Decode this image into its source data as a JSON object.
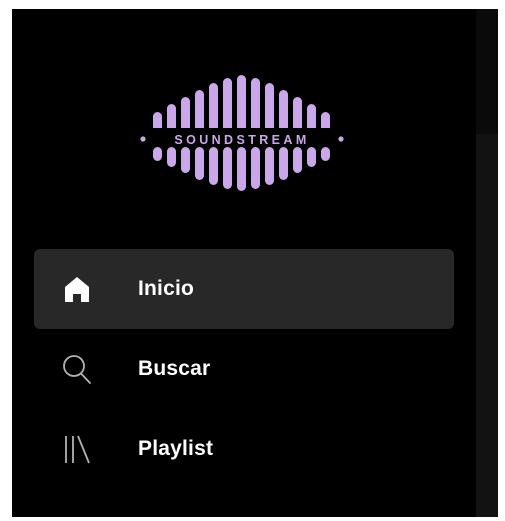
{
  "logo": {
    "text": "SOUNDSTREAM",
    "color": "#c9a7e8"
  },
  "nav": {
    "items": [
      {
        "label": "Inicio",
        "icon": "home-icon",
        "active": true
      },
      {
        "label": "Buscar",
        "icon": "search-icon",
        "active": false
      },
      {
        "label": "Playlist",
        "icon": "library-icon",
        "active": false
      }
    ]
  },
  "colors": {
    "background": "#000000",
    "active_item": "#282828",
    "text": "#ffffff",
    "icon_inactive": "#b3b3b3"
  }
}
